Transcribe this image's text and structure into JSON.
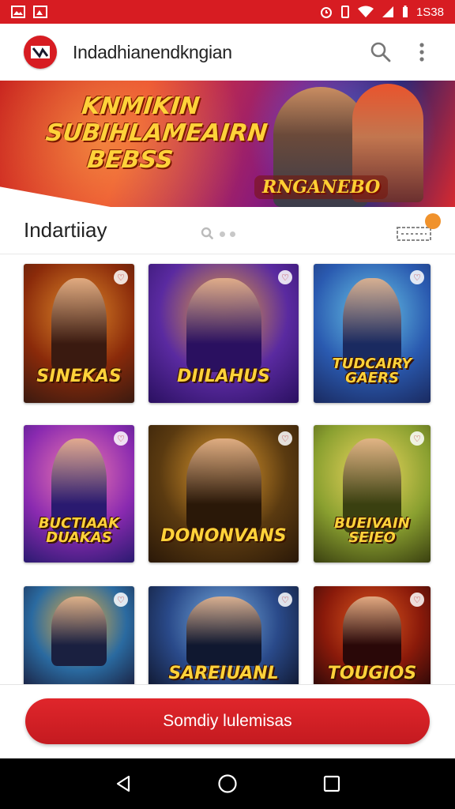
{
  "status_bar": {
    "time": "1S38",
    "left_icons": [
      "image-icon",
      "photo-icon"
    ],
    "right_icons": [
      "alarm-icon",
      "vibrate-icon",
      "wifi-icon",
      "signal-icon",
      "battery-icon"
    ],
    "color": "#d71c22"
  },
  "app_bar": {
    "title": "Indadhianendkngian",
    "actions": [
      "search-icon",
      "more-vert-icon"
    ]
  },
  "banner": {
    "heading_line1": "KNMIKIN",
    "heading_line2": "SUBIHLAMEAIRN",
    "heading_line3": "BEBSS",
    "logo_text": "RNGANEBO"
  },
  "section": {
    "title": "Indartiiay",
    "badge": ""
  },
  "games": [
    {
      "title": "SINEKAS",
      "colors": [
        "#8a2a0a",
        "#e08a2a",
        "#3a1a10"
      ]
    },
    {
      "title": "DIILAHUS",
      "colors": [
        "#5a2aa0",
        "#e8a23a",
        "#2a1060"
      ]
    },
    {
      "title": "TUDCAIRY GAERS",
      "colors": [
        "#2a5ab0",
        "#6ac8e8",
        "#1a2a60"
      ]
    },
    {
      "title": "BUCTIAAK DUAKAS",
      "colors": [
        "#8a2ab0",
        "#f07ab0",
        "#2a1a70"
      ]
    },
    {
      "title": "DONONVANS",
      "colors": [
        "#5a3a10",
        "#e8a030",
        "#2a1808"
      ]
    },
    {
      "title": "BUEIVAIN SEIEO",
      "colors": [
        "#8aa030",
        "#f0d860",
        "#3a4010"
      ]
    },
    {
      "title": "",
      "colors": [
        "#2a6aa0",
        "#e8b040",
        "#1a2040"
      ]
    },
    {
      "title": "SAREIUANL",
      "colors": [
        "#2a4a8a",
        "#7ab0e0",
        "#101830"
      ]
    },
    {
      "title": "TOUGIOS",
      "colors": [
        "#8a1a0a",
        "#e05a20",
        "#2a0808"
      ]
    }
  ],
  "cta": {
    "label": "Somdiy lulemisas",
    "color": "#d71c22"
  },
  "nav_bar": {
    "buttons": [
      "back-icon",
      "home-icon",
      "recents-icon"
    ]
  }
}
